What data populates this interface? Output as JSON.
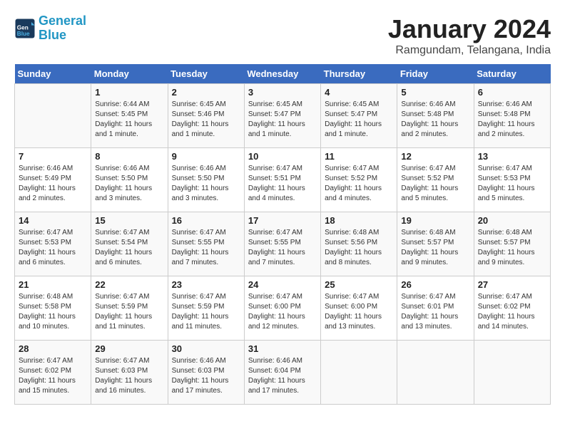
{
  "header": {
    "logo_line1": "General",
    "logo_line2": "Blue",
    "month": "January 2024",
    "location": "Ramgundam, Telangana, India"
  },
  "weekdays": [
    "Sunday",
    "Monday",
    "Tuesday",
    "Wednesday",
    "Thursday",
    "Friday",
    "Saturday"
  ],
  "weeks": [
    [
      {
        "day": "",
        "info": ""
      },
      {
        "day": "1",
        "info": "Sunrise: 6:44 AM\nSunset: 5:45 PM\nDaylight: 11 hours\nand 1 minute."
      },
      {
        "day": "2",
        "info": "Sunrise: 6:45 AM\nSunset: 5:46 PM\nDaylight: 11 hours\nand 1 minute."
      },
      {
        "day": "3",
        "info": "Sunrise: 6:45 AM\nSunset: 5:47 PM\nDaylight: 11 hours\nand 1 minute."
      },
      {
        "day": "4",
        "info": "Sunrise: 6:45 AM\nSunset: 5:47 PM\nDaylight: 11 hours\nand 1 minute."
      },
      {
        "day": "5",
        "info": "Sunrise: 6:46 AM\nSunset: 5:48 PM\nDaylight: 11 hours\nand 2 minutes."
      },
      {
        "day": "6",
        "info": "Sunrise: 6:46 AM\nSunset: 5:48 PM\nDaylight: 11 hours\nand 2 minutes."
      }
    ],
    [
      {
        "day": "7",
        "info": "Sunrise: 6:46 AM\nSunset: 5:49 PM\nDaylight: 11 hours\nand 2 minutes."
      },
      {
        "day": "8",
        "info": "Sunrise: 6:46 AM\nSunset: 5:50 PM\nDaylight: 11 hours\nand 3 minutes."
      },
      {
        "day": "9",
        "info": "Sunrise: 6:46 AM\nSunset: 5:50 PM\nDaylight: 11 hours\nand 3 minutes."
      },
      {
        "day": "10",
        "info": "Sunrise: 6:47 AM\nSunset: 5:51 PM\nDaylight: 11 hours\nand 4 minutes."
      },
      {
        "day": "11",
        "info": "Sunrise: 6:47 AM\nSunset: 5:52 PM\nDaylight: 11 hours\nand 4 minutes."
      },
      {
        "day": "12",
        "info": "Sunrise: 6:47 AM\nSunset: 5:52 PM\nDaylight: 11 hours\nand 5 minutes."
      },
      {
        "day": "13",
        "info": "Sunrise: 6:47 AM\nSunset: 5:53 PM\nDaylight: 11 hours\nand 5 minutes."
      }
    ],
    [
      {
        "day": "14",
        "info": "Sunrise: 6:47 AM\nSunset: 5:53 PM\nDaylight: 11 hours\nand 6 minutes."
      },
      {
        "day": "15",
        "info": "Sunrise: 6:47 AM\nSunset: 5:54 PM\nDaylight: 11 hours\nand 6 minutes."
      },
      {
        "day": "16",
        "info": "Sunrise: 6:47 AM\nSunset: 5:55 PM\nDaylight: 11 hours\nand 7 minutes."
      },
      {
        "day": "17",
        "info": "Sunrise: 6:47 AM\nSunset: 5:55 PM\nDaylight: 11 hours\nand 7 minutes."
      },
      {
        "day": "18",
        "info": "Sunrise: 6:48 AM\nSunset: 5:56 PM\nDaylight: 11 hours\nand 8 minutes."
      },
      {
        "day": "19",
        "info": "Sunrise: 6:48 AM\nSunset: 5:57 PM\nDaylight: 11 hours\nand 9 minutes."
      },
      {
        "day": "20",
        "info": "Sunrise: 6:48 AM\nSunset: 5:57 PM\nDaylight: 11 hours\nand 9 minutes."
      }
    ],
    [
      {
        "day": "21",
        "info": "Sunrise: 6:48 AM\nSunset: 5:58 PM\nDaylight: 11 hours\nand 10 minutes."
      },
      {
        "day": "22",
        "info": "Sunrise: 6:47 AM\nSunset: 5:59 PM\nDaylight: 11 hours\nand 11 minutes."
      },
      {
        "day": "23",
        "info": "Sunrise: 6:47 AM\nSunset: 5:59 PM\nDaylight: 11 hours\nand 11 minutes."
      },
      {
        "day": "24",
        "info": "Sunrise: 6:47 AM\nSunset: 6:00 PM\nDaylight: 11 hours\nand 12 minutes."
      },
      {
        "day": "25",
        "info": "Sunrise: 6:47 AM\nSunset: 6:00 PM\nDaylight: 11 hours\nand 13 minutes."
      },
      {
        "day": "26",
        "info": "Sunrise: 6:47 AM\nSunset: 6:01 PM\nDaylight: 11 hours\nand 13 minutes."
      },
      {
        "day": "27",
        "info": "Sunrise: 6:47 AM\nSunset: 6:02 PM\nDaylight: 11 hours\nand 14 minutes."
      }
    ],
    [
      {
        "day": "28",
        "info": "Sunrise: 6:47 AM\nSunset: 6:02 PM\nDaylight: 11 hours\nand 15 minutes."
      },
      {
        "day": "29",
        "info": "Sunrise: 6:47 AM\nSunset: 6:03 PM\nDaylight: 11 hours\nand 16 minutes."
      },
      {
        "day": "30",
        "info": "Sunrise: 6:46 AM\nSunset: 6:03 PM\nDaylight: 11 hours\nand 17 minutes."
      },
      {
        "day": "31",
        "info": "Sunrise: 6:46 AM\nSunset: 6:04 PM\nDaylight: 11 hours\nand 17 minutes."
      },
      {
        "day": "",
        "info": ""
      },
      {
        "day": "",
        "info": ""
      },
      {
        "day": "",
        "info": ""
      }
    ]
  ]
}
